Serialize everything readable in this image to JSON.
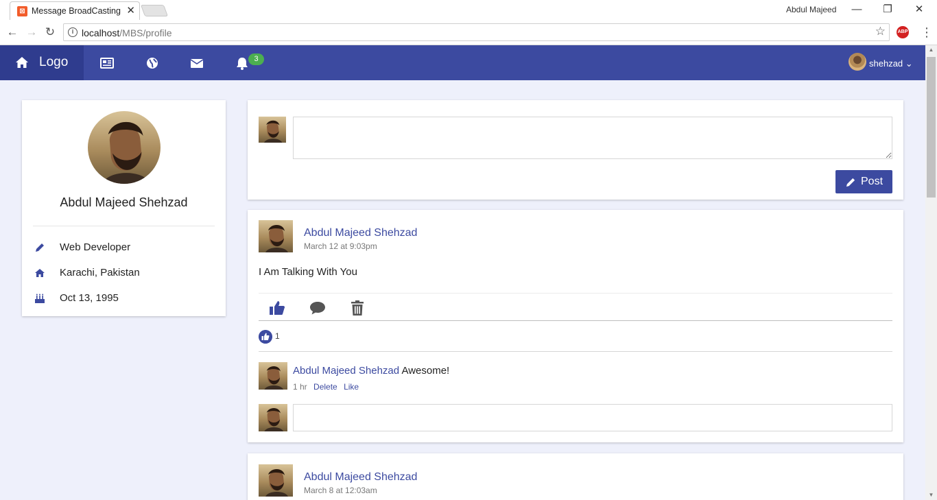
{
  "browser": {
    "tab_title": "Message BroadCasting S",
    "window_user": "Abdul Majeed",
    "url_host": "localhost",
    "url_path": "/MBS/profile"
  },
  "navbar": {
    "brand": "Logo",
    "notification_count": "3",
    "username": "shehzad"
  },
  "profile": {
    "name": "Abdul Majeed Shehzad",
    "details": [
      {
        "icon": "pencil-icon",
        "text": "Web Developer"
      },
      {
        "icon": "home-icon",
        "text": "Karachi, Pakistan"
      },
      {
        "icon": "birthday-cake-icon",
        "text": "Oct 13, 1995"
      }
    ]
  },
  "composer": {
    "placeholder": "",
    "post_label": "Post"
  },
  "posts": [
    {
      "author": "Abdul Majeed Shehzad",
      "time": "March 12 at 9:03pm",
      "text": "I Am Talking With You",
      "likes": "1",
      "comments": [
        {
          "author": "Abdul Majeed Shehzad",
          "text": "Awesome!",
          "time": "1 hr",
          "delete_label": "Delete",
          "like_label": "Like"
        }
      ],
      "comment_placeholder": ""
    },
    {
      "author": "Abdul Majeed Shehzad",
      "time": "March 8 at 12:03am"
    }
  ],
  "colors": {
    "primary": "#3c4aa0",
    "brand_dark": "#2f3c8e",
    "badge": "#4caf50",
    "background": "#eef0fb"
  }
}
